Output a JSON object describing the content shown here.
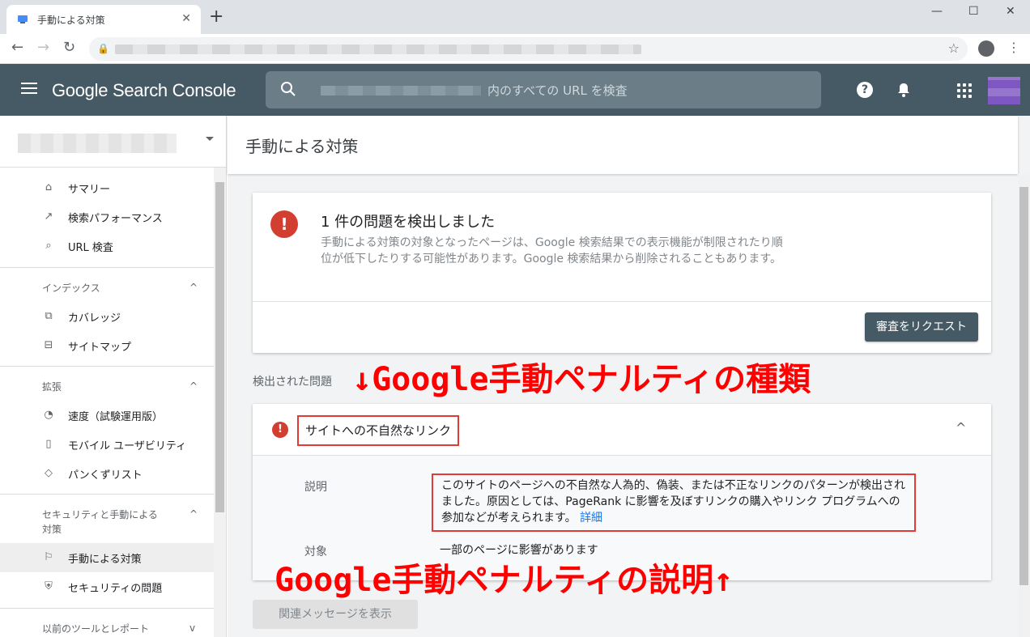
{
  "browser": {
    "tab_title": "手動による対策",
    "new_tab": "+",
    "tab_close": "✕",
    "minimize": "—",
    "maximize": "☐",
    "close": "✕",
    "back": "←",
    "forward": "→",
    "reload": "↻",
    "lock": "🔒",
    "star": "☆",
    "menu": "⋮"
  },
  "header": {
    "product": "Google Search Console",
    "search_placeholder": "内のすべての URL を検査",
    "help": "?",
    "bell": "🔔"
  },
  "sidebar": {
    "top_items": [
      {
        "label": "サマリー",
        "icon": "home-icon",
        "glyph": "⌂"
      },
      {
        "label": "検索パフォーマンス",
        "icon": "trending-icon",
        "glyph": "↗"
      },
      {
        "label": "URL 検査",
        "icon": "search-icon",
        "glyph": "⌕"
      }
    ],
    "index_header": "インデックス",
    "index_items": [
      {
        "label": "カバレッジ",
        "icon": "copy-icon",
        "glyph": "⧉"
      },
      {
        "label": "サイトマップ",
        "icon": "sitemap-icon",
        "glyph": "⊟"
      }
    ],
    "ext_header": "拡張",
    "ext_items": [
      {
        "label": "速度（試験運用版）",
        "icon": "speed-icon",
        "glyph": "◔"
      },
      {
        "label": "モバイル ユーザビリティ",
        "icon": "phone-icon",
        "glyph": "▯"
      },
      {
        "label": "パンくずリスト",
        "icon": "layers-icon",
        "glyph": "◇"
      }
    ],
    "security_header": "セキュリティと手動による\n対策",
    "security_items": [
      {
        "label": "手動による対策",
        "icon": "flag-icon",
        "glyph": "⚐"
      },
      {
        "label": "セキュリティの問題",
        "icon": "shield-icon",
        "glyph": "⛨"
      }
    ],
    "legacy_header": "以前のツールとレポート",
    "chev_up": "^",
    "chev_down": "v"
  },
  "main": {
    "page_title": "手動による対策",
    "issue_count_title": "1 件の問題を検出しました",
    "issue_desc": "手動による対策の対象となったページは、Google 検索結果での表示機能が制限されたり順位が低下したりする可能性があります。Google 検索結果から削除されることもあります。",
    "error_glyph": "!",
    "request_review": "審査をリクエスト",
    "detected_label": "検出された問題",
    "issue_name": "サイトへの不自然なリンク",
    "desc_label": "説明",
    "description": "このサイトのページへの不自然な人為的、偽装、または不正なリンクのパターンが検出されました。原因としては、PageRank に影響を及ぼすリンクの購入やリンク プログラムへの参加などが考えられます。",
    "more_link": "詳細",
    "target_label": "対象",
    "target_value": "一部のページに影響があります",
    "view_messages": "関連メッセージを表示",
    "chev_up": "^"
  },
  "annotations": {
    "types": "↓Google手動ペナルティの種類",
    "explanation": "Google手動ペナルティの説明↑",
    "color": "#ff0000"
  }
}
